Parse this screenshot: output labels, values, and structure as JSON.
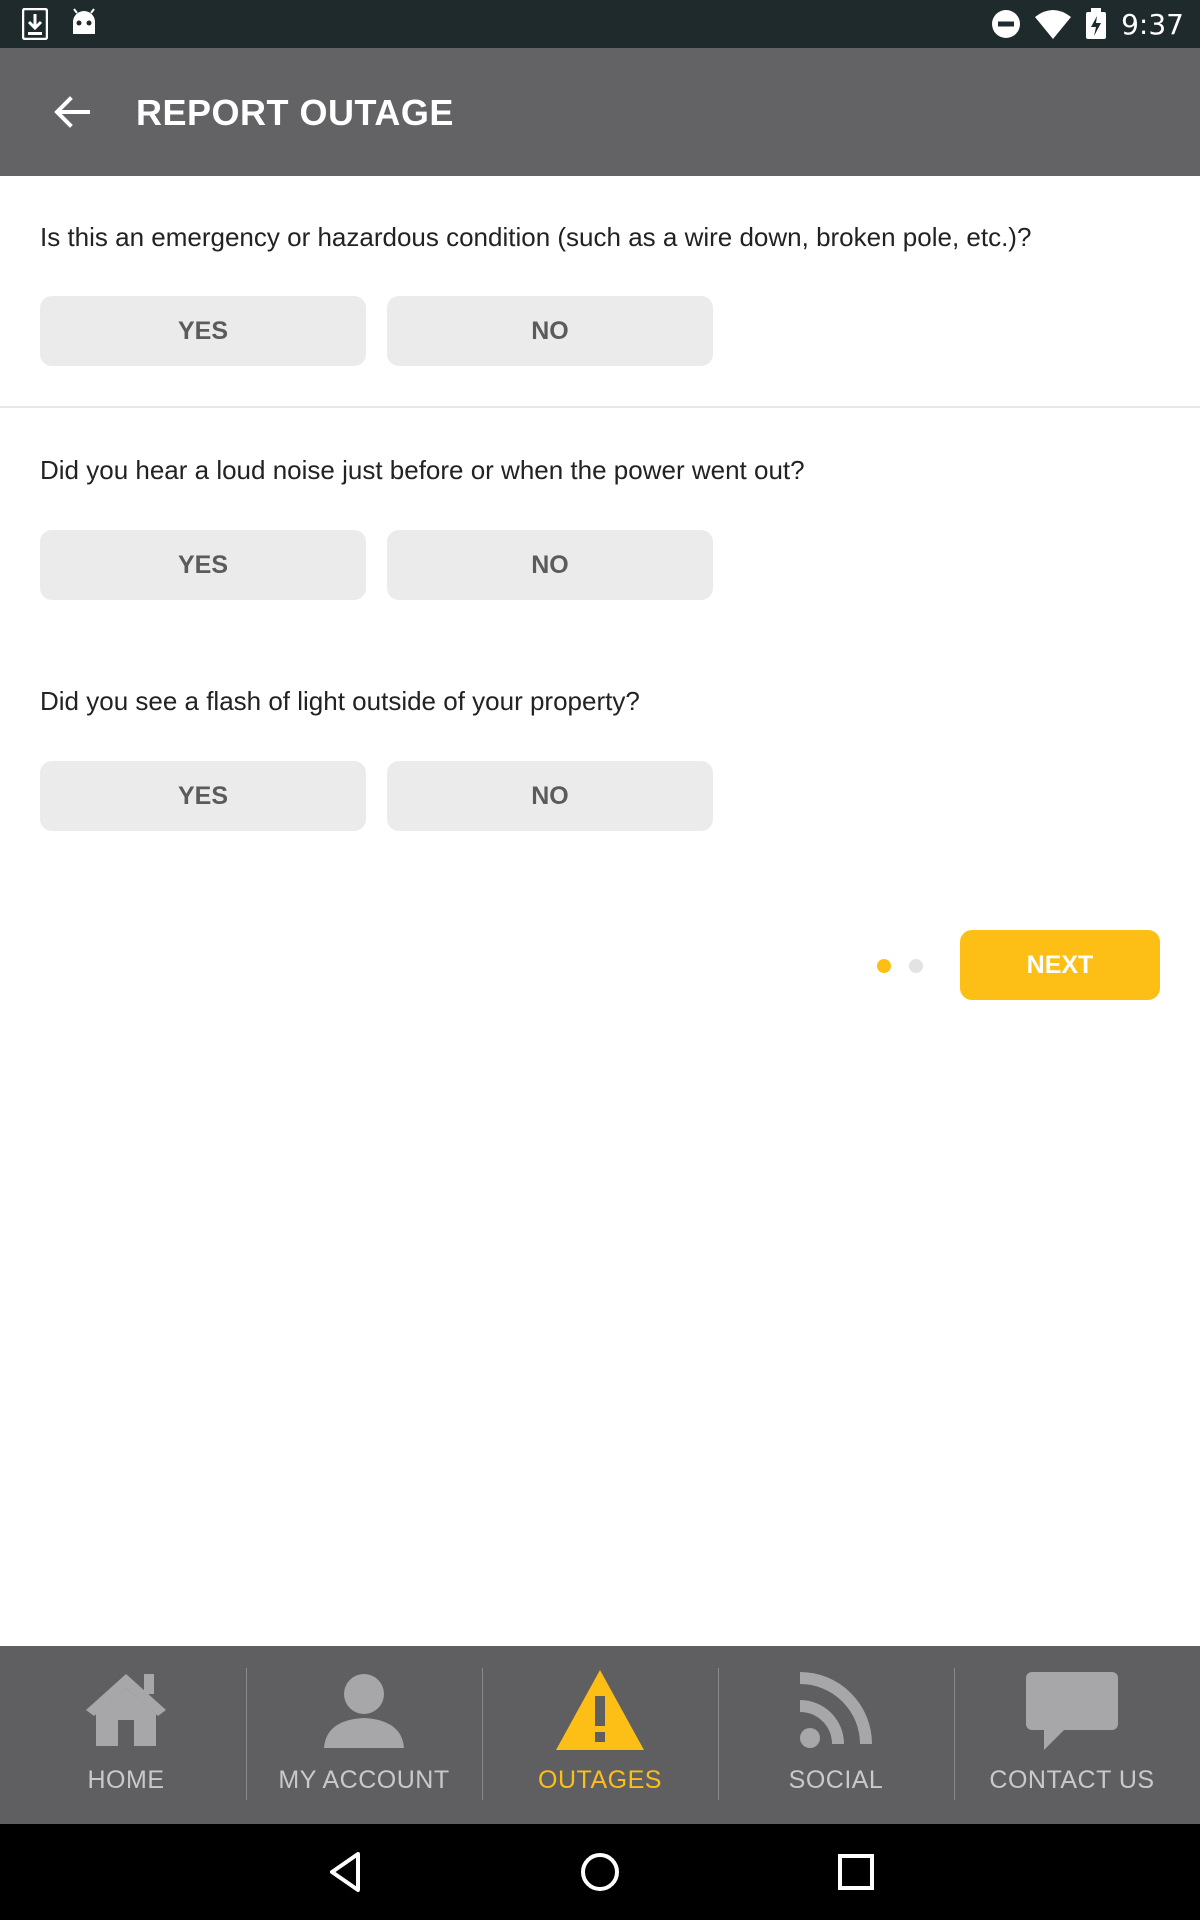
{
  "status_bar": {
    "time": "9:37",
    "icons": [
      "download-icon",
      "android-icon",
      "do-not-disturb-icon",
      "wifi-icon",
      "battery-charging-icon"
    ]
  },
  "app_bar": {
    "title": "REPORT OUTAGE",
    "back_icon": "arrow-left-icon"
  },
  "questions": [
    {
      "text": "Is this an emergency or hazardous condition (such as a wire down, broken pole, etc.)?",
      "yes_label": "YES",
      "no_label": "NO"
    },
    {
      "text": "Did you hear a loud noise just before or when the power went out?",
      "yes_label": "YES",
      "no_label": "NO"
    },
    {
      "text": "Did you see a flash of light outside of your property?",
      "yes_label": "YES",
      "no_label": "NO"
    }
  ],
  "pager": {
    "current_page": 1,
    "total_pages": 2
  },
  "next_label": "NEXT",
  "bottom_nav": {
    "items": [
      {
        "label": "HOME",
        "icon": "home-icon",
        "active": false
      },
      {
        "label": "MY ACCOUNT",
        "icon": "person-icon",
        "active": false
      },
      {
        "label": "OUTAGES",
        "icon": "warning-icon",
        "active": true
      },
      {
        "label": "SOCIAL",
        "icon": "rss-icon",
        "active": false
      },
      {
        "label": "CONTACT US",
        "icon": "chat-bubble-icon",
        "active": false
      }
    ]
  },
  "colors": {
    "accent": "#fdbf16",
    "app_bar": "#636365",
    "status_bar": "#1f2a2c",
    "button_bg": "#ebebeb",
    "nav_bg": "#5f5f61"
  }
}
